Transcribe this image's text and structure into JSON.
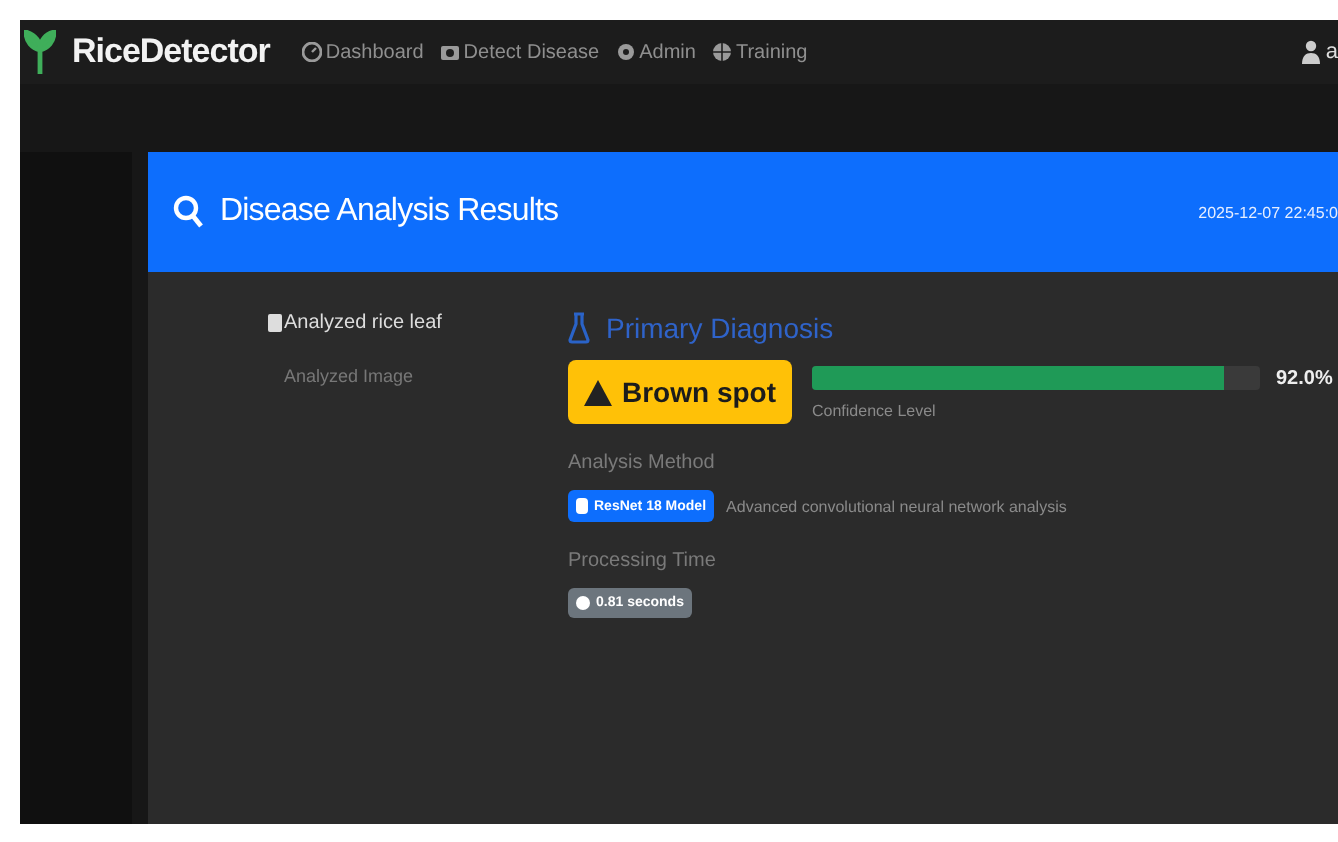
{
  "navbar": {
    "brand": "RiceDetector",
    "items": [
      {
        "label": "Dashboard"
      },
      {
        "label": "Detect Disease"
      },
      {
        "label": "Admin"
      },
      {
        "label": "Training"
      }
    ],
    "user": "a"
  },
  "card": {
    "title": "Disease Analysis Results",
    "timestamp": "2025-12-07 22:45:0",
    "image_alt": "Analyzed rice leaf",
    "image_caption": "Analyzed Image",
    "section_title": "Primary Diagnosis",
    "diagnosis": "Brown spot",
    "confidence": {
      "level": 0.92,
      "reading": "92.0%",
      "label": "Confidence Level"
    },
    "method_label": "Analysis Method",
    "method_badge": "ResNet 18 Model",
    "method_description": "Advanced convolutional neural network analysis",
    "time_label": "Processing Time",
    "time_badge": "0.81 seconds"
  }
}
